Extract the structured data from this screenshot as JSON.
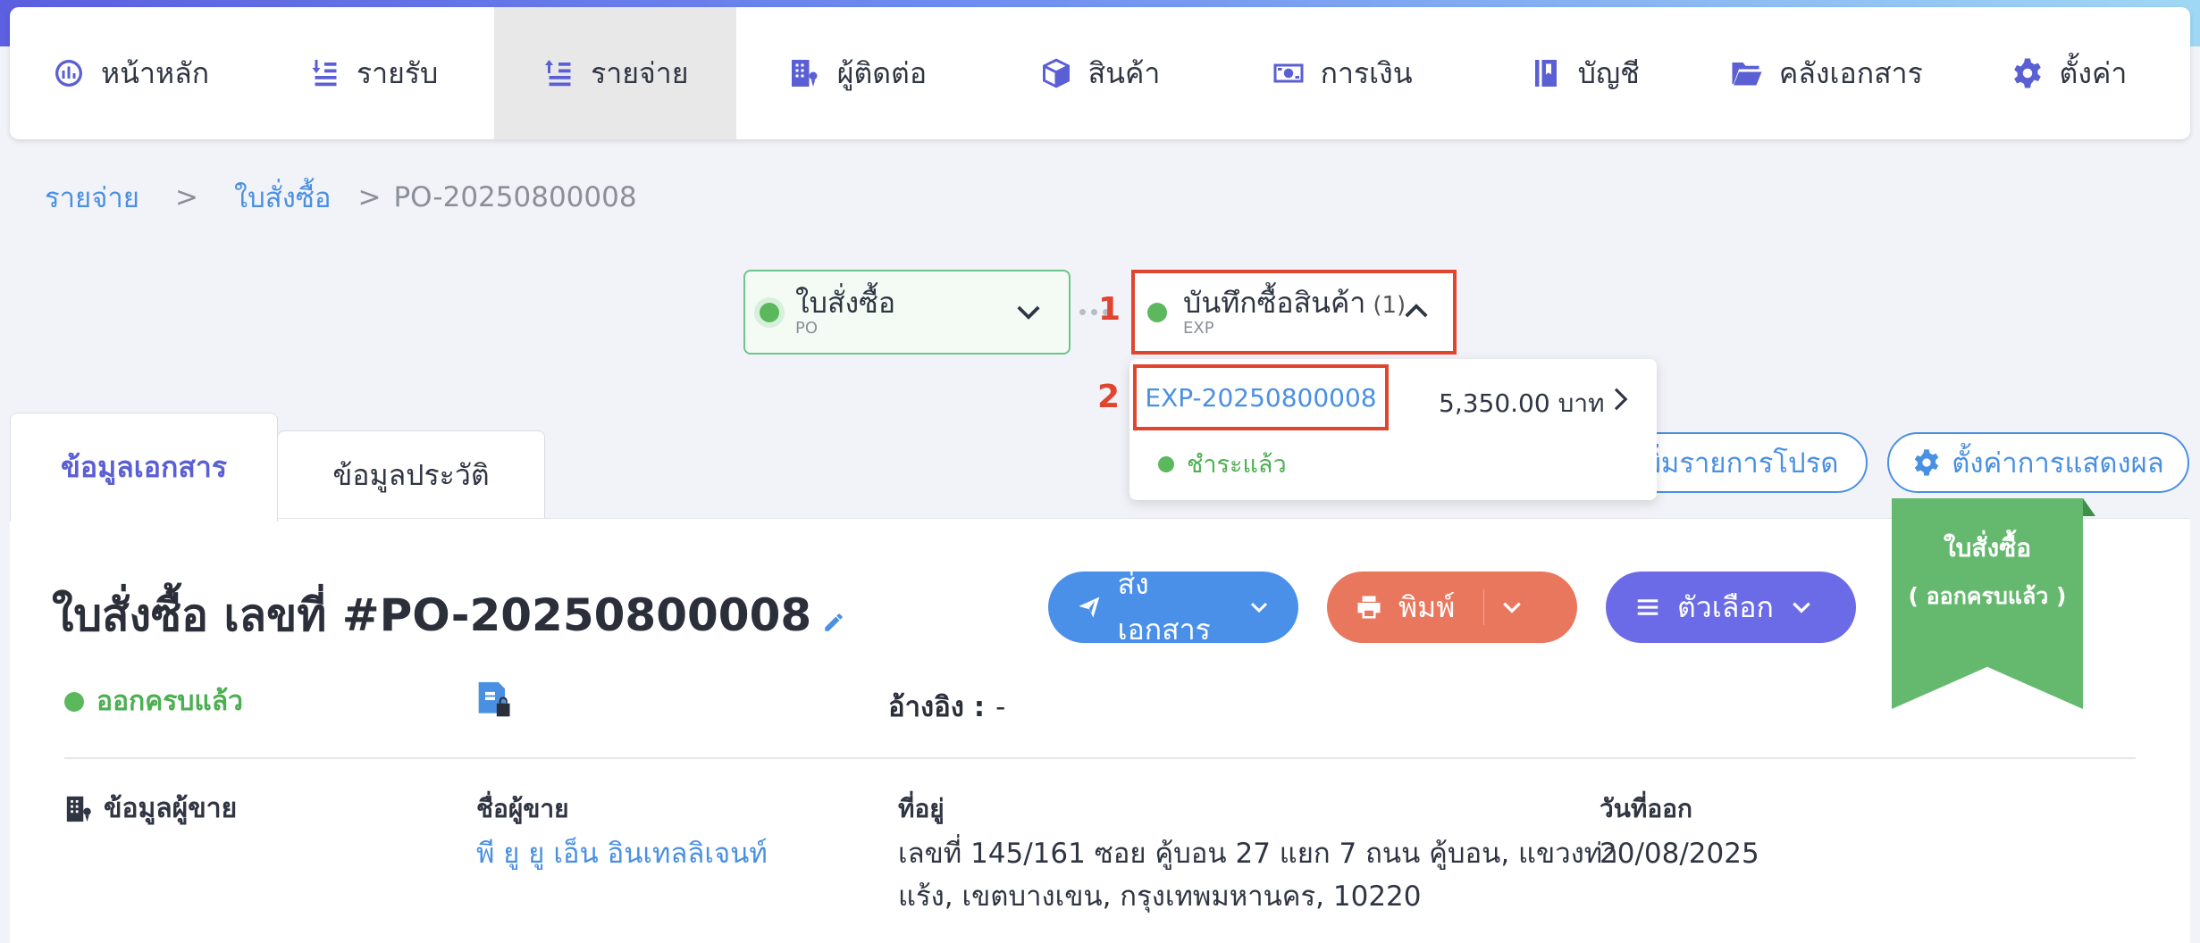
{
  "nav": {
    "items": [
      {
        "label": "หน้าหลัก",
        "icon": "dashboard-icon"
      },
      {
        "label": "รายรับ",
        "icon": "income-icon"
      },
      {
        "label": "รายจ่าย",
        "icon": "expense-icon",
        "active": true
      },
      {
        "label": "ผู้ติดต่อ",
        "icon": "contacts-icon"
      },
      {
        "label": "สินค้า",
        "icon": "box-icon"
      },
      {
        "label": "การเงิน",
        "icon": "money-icon"
      },
      {
        "label": "บัญชี",
        "icon": "book-icon"
      },
      {
        "label": "คลังเอกสาร",
        "icon": "folder-icon"
      },
      {
        "label": "ตั้งค่า",
        "icon": "gear-icon"
      }
    ]
  },
  "breadcrumb": {
    "level1": "รายจ่าย",
    "sep": ">",
    "level2": "ใบสั่งซื้อ",
    "current": "PO-20250800008"
  },
  "flow": {
    "po": {
      "title": "ใบสั่งซื้อ",
      "sub": "PO"
    },
    "exp": {
      "title": "บันทึกซื้อสินค้า",
      "count": "(1)",
      "sub": "EXP"
    },
    "marker1": "1",
    "marker2": "2",
    "dropdown": {
      "doc_id": "EXP-20250800008",
      "amount": "5,350.00 บาท",
      "status": "ชำระแล้ว"
    }
  },
  "tabs": {
    "doc_info": "ข้อมูลเอกสาร",
    "history": "ข้อมูลประวัติ"
  },
  "actions": {
    "add_fav": "พิ่มรายการโปรด",
    "display_settings": "ตั้งค่าการแสดงผล",
    "send": "ส่งเอกสาร",
    "print": "พิมพ์",
    "options": "ตัวเลือก"
  },
  "document": {
    "title": "ใบสั่งซื้อ เลขที่ #PO-20250800008",
    "status": "ออกครบแล้ว",
    "ref_label": "อ้างอิง :",
    "ref_value": "-",
    "ribbon_line1": "ใบสั่งซื้อ",
    "ribbon_line2": "( ออกครบแล้ว )"
  },
  "vendor": {
    "section_label": "ข้อมูลผู้ขาย",
    "name_label": "ชื่อผู้ขาย",
    "name": "พี ยู ยู เอ็น อินเทลลิเจนท์",
    "address_label": "ที่อยู่",
    "address_line1": "เลขที่ 145/161 ซอย คู้บอน 27 แยก 7 ถนน คู้บอน, แขวงท่า",
    "address_line2": "แร้ง, เขตบางเขน, กรุงเทพมหานคร, 10220",
    "date_label": "วันที่ออก",
    "date": "20/08/2025"
  },
  "colors": {
    "brand": "#5b5fd4",
    "link": "#4a90e2",
    "success": "#4caf50",
    "highlight": "#e0452f",
    "send_btn": "#4a90e8",
    "print_btn": "#e8775e",
    "options_btn": "#6b6be8"
  }
}
